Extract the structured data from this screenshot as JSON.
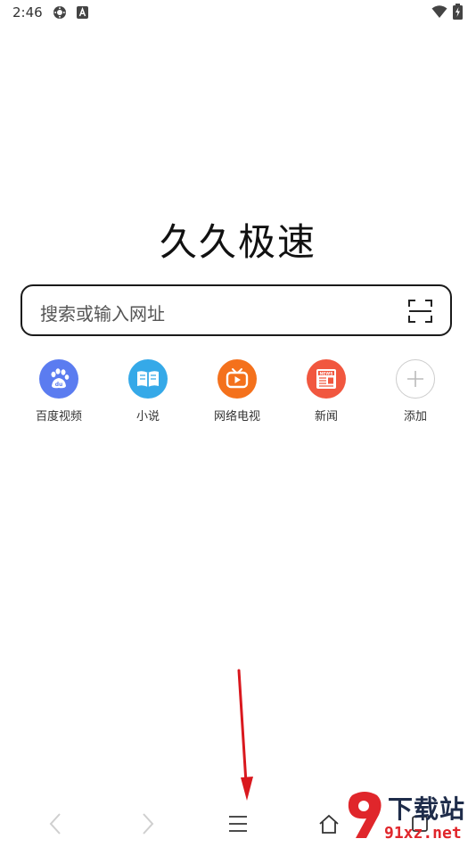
{
  "status_bar": {
    "time": "2:46",
    "icons": [
      "settings-gear-icon",
      "a-badge-icon",
      "wifi-icon",
      "battery-charging-icon"
    ]
  },
  "brand": {
    "title": "久久极速"
  },
  "search": {
    "placeholder": "搜索或输入网址",
    "scan_icon": "scan-frame-icon"
  },
  "shortcuts": [
    {
      "label": "百度视频",
      "icon": "baidu-paw-icon",
      "color": "#5b7cf0"
    },
    {
      "label": "小说",
      "icon": "open-book-icon",
      "color": "#35a9e8"
    },
    {
      "label": "网络电视",
      "icon": "tv-play-icon",
      "color": "#f4711c"
    },
    {
      "label": "新闻",
      "icon": "newspaper-icon",
      "color": "#f1573f"
    },
    {
      "label": "添加",
      "icon": "plus-icon",
      "color": "#cccccc"
    }
  ],
  "bottom_nav": {
    "items": [
      "back-icon",
      "forward-icon",
      "menu-icon",
      "home-icon",
      "tabs-icon"
    ]
  },
  "watermark": {
    "top": "下载站",
    "bottom": "91xz.net"
  },
  "colors": {
    "accent_arrow": "#d9181e",
    "border": "#1a1a1a"
  }
}
